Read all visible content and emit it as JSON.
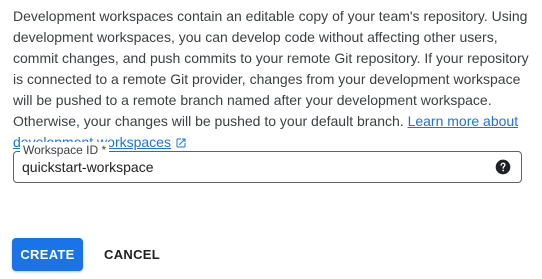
{
  "description": {
    "text": "Development workspaces contain an editable copy of your team's repository. Using development workspaces, you can develop code without affecting other users, commit changes, and push commits to your remote Git repository. If your repository is connected to a remote Git provider, changes from your development workspace will be pushed to a remote branch named after your development workspace. Otherwise, your changes will be pushed to your default branch.",
    "link_label": "Learn more about development workspaces",
    "link_icon": "open-in-new-icon"
  },
  "workspace_field": {
    "label": "Workspace ID *",
    "value": "quickstart-workspace",
    "help_icon": "help-circle-icon"
  },
  "actions": {
    "create_label": "CREATE",
    "cancel_label": "CANCEL"
  },
  "colors": {
    "primary": "#1a73e8",
    "text": "#3c4043",
    "link": "#1a73e8"
  }
}
